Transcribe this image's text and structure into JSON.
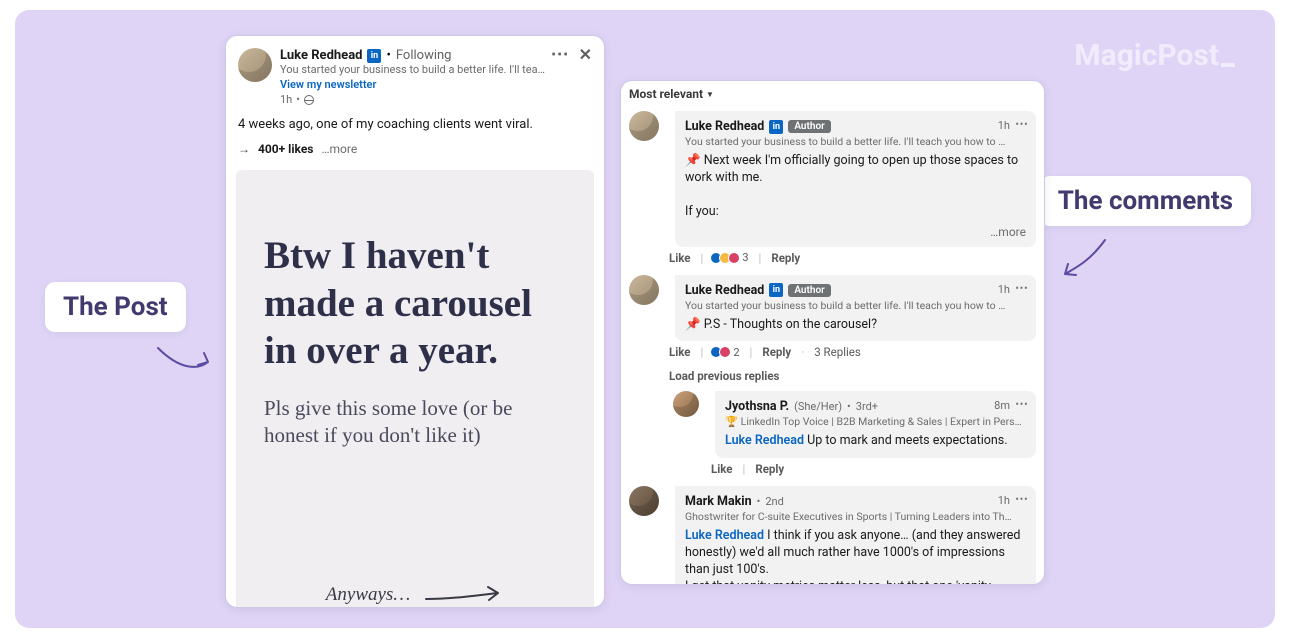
{
  "brand": "MagicPost",
  "callouts": {
    "post": "The Post",
    "comments": "The comments"
  },
  "post": {
    "author": "Luke Redhead",
    "relation": "Following",
    "byline": "You started your business to build a better life. I'll tea…",
    "newsletter": "View my newsletter",
    "age": "1h",
    "body": "4 weeks ago, one of my coaching clients went viral.",
    "likes_arrow": "→",
    "likes": "400+ likes",
    "more": "…more",
    "carousel": {
      "headline": "Btw I haven't made a carousel in over a year.",
      "sub": "Pls give this some love (or be honest if you don't like it)",
      "anyways": "Anyways…"
    }
  },
  "sort": "Most relevant",
  "comments": {
    "c1": {
      "name": "Luke Redhead",
      "badge": "Author",
      "time": "1h",
      "byline": "You started your business to build a better life. I'll teach you how to …",
      "body": "Next week I'm officially going to open up those spaces to work with me.",
      "body2": "If you:",
      "more": "…more",
      "react_count": "3",
      "like": "Like",
      "reply": "Reply"
    },
    "c2": {
      "name": "Luke Redhead",
      "badge": "Author",
      "time": "1h",
      "byline": "You started your business to build a better life. I'll teach you how to …",
      "body": "P.S - Thoughts on the carousel?",
      "react_count": "2",
      "like": "Like",
      "reply": "Reply",
      "replies": "3 Replies"
    },
    "load_prev": "Load previous replies",
    "r1": {
      "name": "Jyothsna P.",
      "pronoun": "(She/Her)",
      "rel": "3rd+",
      "time": "8m",
      "byline": "🏆 LinkedIn Top Voice | B2B Marketing & Sales | Expert in Pers…",
      "mention": "Luke Redhead",
      "body": "Up to mark and meets expectations.",
      "like": "Like",
      "reply": "Reply"
    },
    "c3": {
      "name": "Mark Makin",
      "rel": "2nd",
      "time": "1h",
      "byline": "Ghostwriter for C-suite Executives in Sports | Turning Leaders into Th…",
      "mention": "Luke Redhead",
      "body1": "I think if you ask anyone… (and they answered honestly) we'd all much rather have 1000's of impressions than just 100's.",
      "body2": "I get that vanity metrics matter less, but that one 'vanity metric' (or"
    }
  }
}
